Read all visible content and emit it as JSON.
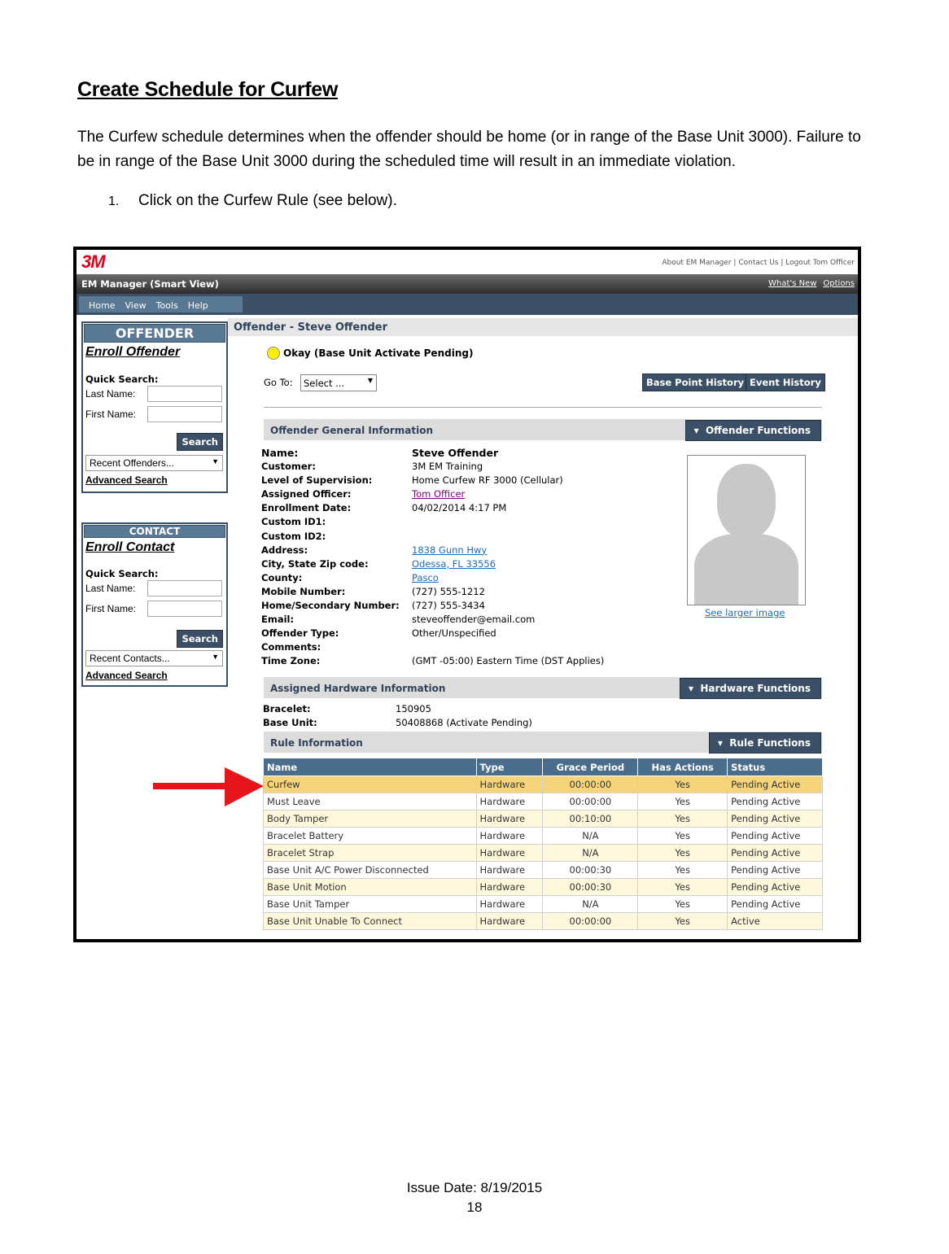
{
  "doc": {
    "title": "Create Schedule for Curfew",
    "paragraph": "The Curfew schedule determines when the offender should be home (or in range of the Base Unit 3000).  Failure to be in range of the Base Unit 3000 during the scheduled time will result in an immediate violation.",
    "step_number": "1.",
    "step_text": "Click on the Curfew Rule (see below).",
    "footer_date": "Issue Date: 8/19/2015",
    "footer_page": "18"
  },
  "app": {
    "logo": "3M",
    "top_links": "About EM Manager | Contact Us | Logout Tom Officer",
    "title": "EM Manager (Smart View)",
    "whats_new": "What's New",
    "options": "Options",
    "menu": [
      "Home",
      "View",
      "Tools",
      "Help"
    ]
  },
  "sidebar": {
    "offender": {
      "header": "OFFENDER",
      "enroll": "Enroll Offender",
      "quick_search": "Quick Search:",
      "last_name": "Last Name:",
      "first_name": "First Name:",
      "search": "Search",
      "recent": "Recent Offenders...",
      "advanced": "Advanced Search"
    },
    "contact": {
      "header": "CONTACT",
      "enroll": "Enroll Contact",
      "quick_search": "Quick Search:",
      "last_name": "Last Name:",
      "first_name": "First Name:",
      "search": "Search",
      "recent": "Recent Contacts...",
      "advanced": "Advanced Search"
    }
  },
  "main": {
    "header": "Offender - Steve Offender",
    "status": "Okay (Base Unit Activate Pending)",
    "status_color": "#ffef00",
    "goto_label": "Go To:",
    "goto_value": "Select ...",
    "base_point_history": "Base Point History",
    "event_history": "Event History",
    "general": {
      "title": "Offender General Information",
      "functions": "Offender Functions",
      "fields": [
        {
          "k": "Name:",
          "v": "Steve Offender",
          "style": "name"
        },
        {
          "k": "Customer:",
          "v": "3M EM Training",
          "style": ""
        },
        {
          "k": "Level of Supervision:",
          "v": "Home Curfew RF 3000 (Cellular)",
          "style": ""
        },
        {
          "k": "Assigned Officer:",
          "v": "Tom Officer",
          "style": "purple"
        },
        {
          "k": "Enrollment Date:",
          "v": "04/02/2014 4:17 PM",
          "style": ""
        },
        {
          "k": "Custom ID1:",
          "v": "",
          "style": ""
        },
        {
          "k": "Custom ID2:",
          "v": "",
          "style": ""
        },
        {
          "k": "Address:",
          "v": "1838 Gunn Hwy",
          "style": "link"
        },
        {
          "k": "City, State Zip code:",
          "v": "Odessa, FL 33556",
          "style": "link"
        },
        {
          "k": "County:",
          "v": "Pasco",
          "style": "link"
        },
        {
          "k": "Mobile Number:",
          "v": "(727) 555-1212",
          "style": ""
        },
        {
          "k": "Home/Secondary Number:",
          "v": "(727) 555-3434",
          "style": ""
        },
        {
          "k": "Email:",
          "v": "steveoffender@email.com",
          "style": ""
        },
        {
          "k": "Offender Type:",
          "v": "Other/Unspecified",
          "style": ""
        },
        {
          "k": "Comments:",
          "v": "",
          "style": ""
        },
        {
          "k": "Time Zone:",
          "v": "(GMT -05:00) Eastern Time (DST Applies)",
          "style": ""
        }
      ],
      "see_larger": "See larger image"
    },
    "hardware": {
      "title": "Assigned Hardware Information",
      "functions": "Hardware Functions",
      "bracelet_label": "Bracelet:",
      "bracelet_value": "150905",
      "base_unit_label": "Base Unit:",
      "base_unit_value": "50408868 (Activate Pending)"
    },
    "rules": {
      "title": "Rule Information",
      "functions": "Rule Functions",
      "columns": [
        "Name",
        "Type",
        "Grace Period",
        "Has Actions",
        "Status"
      ],
      "rows": [
        [
          "Curfew",
          "Hardware",
          "00:00:00",
          "Yes",
          "Pending Active"
        ],
        [
          "Must Leave",
          "Hardware",
          "00:00:00",
          "Yes",
          "Pending Active"
        ],
        [
          "Body Tamper",
          "Hardware",
          "00:10:00",
          "Yes",
          "Pending Active"
        ],
        [
          "Bracelet Battery",
          "Hardware",
          "N/A",
          "Yes",
          "Pending Active"
        ],
        [
          "Bracelet Strap",
          "Hardware",
          "N/A",
          "Yes",
          "Pending Active"
        ],
        [
          "Base Unit A/C Power Disconnected",
          "Hardware",
          "00:00:30",
          "Yes",
          "Pending Active"
        ],
        [
          "Base Unit Motion",
          "Hardware",
          "00:00:30",
          "Yes",
          "Pending Active"
        ],
        [
          "Base Unit Tamper",
          "Hardware",
          "N/A",
          "Yes",
          "Pending Active"
        ],
        [
          "Base Unit Unable To Connect",
          "Hardware",
          "00:00:00",
          "Yes",
          "Active"
        ]
      ]
    }
  },
  "colors": {
    "arrow": "#e8141b",
    "highlight_row": "#f5d47a",
    "nav_dark": "#3b5066"
  }
}
